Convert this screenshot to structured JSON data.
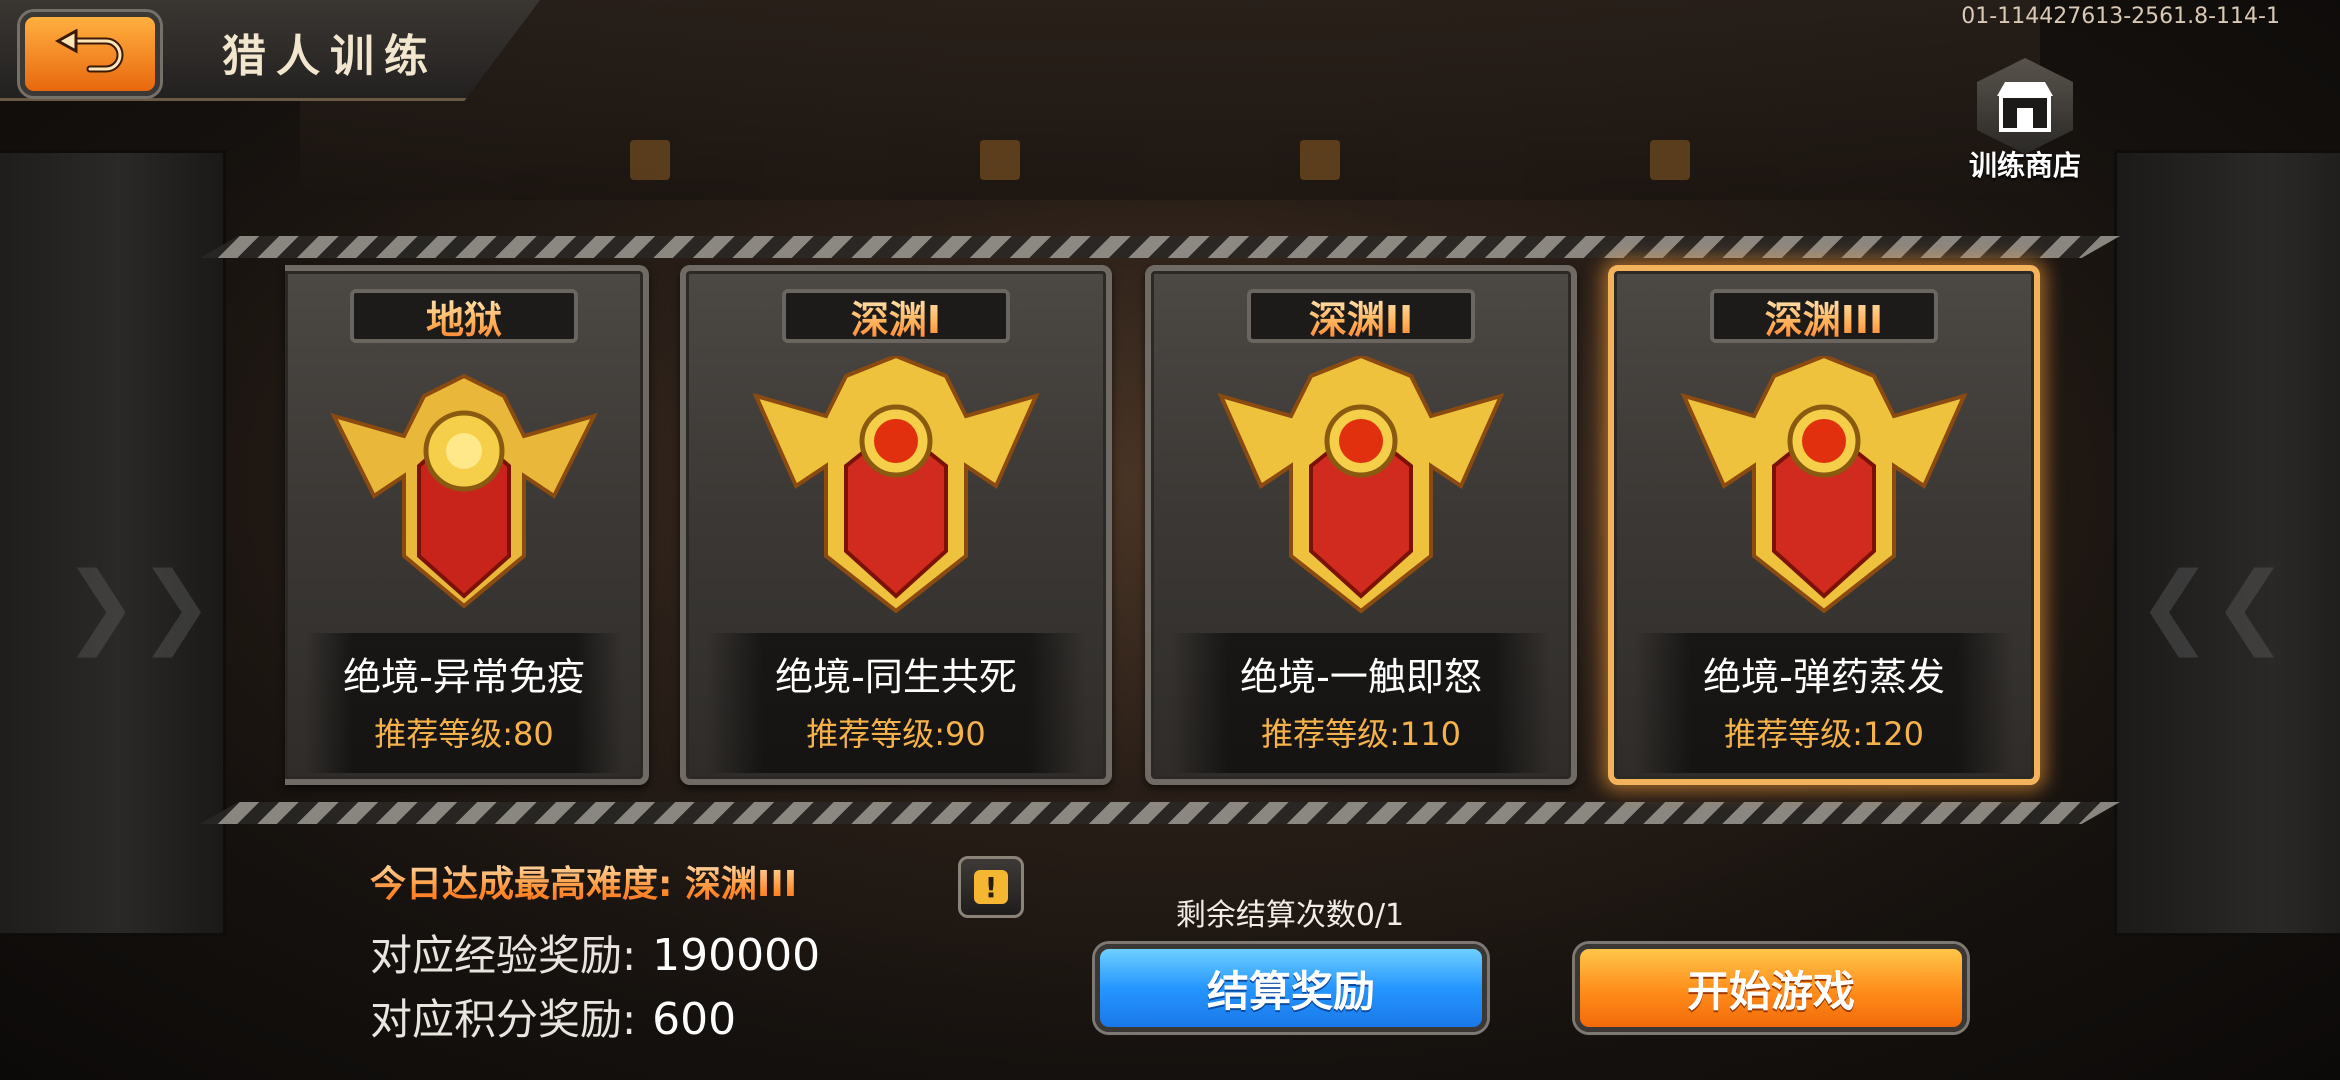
{
  "header": {
    "title": "猎人训练",
    "build_id": "01-114427613-2561.8-114-1"
  },
  "shop": {
    "label": "训练商店",
    "icon": "shop-icon"
  },
  "cards": [
    {
      "tab": "地狱",
      "name": "绝境-异常免疫",
      "level": "推荐等级:80",
      "selected": false
    },
    {
      "tab": "深渊I",
      "name": "绝境-同生共死",
      "level": "推荐等级:90",
      "selected": false
    },
    {
      "tab": "深渊II",
      "name": "绝境-一触即怒",
      "level": "推荐等级:110",
      "selected": false
    },
    {
      "tab": "深渊III",
      "name": "绝境-弹药蒸发",
      "level": "推荐等级:120",
      "selected": true
    }
  ],
  "summary": {
    "best_difficulty": "今日达成最高难度: 深渊III",
    "exp_label": "对应经验奖励:",
    "exp_value": "190000",
    "points_label": "对应积分奖励:",
    "points_value": "600",
    "info_icon": "!"
  },
  "actions": {
    "remaining": "剩余结算次数0/1",
    "settle": "结算奖励",
    "start": "开始游戏"
  },
  "colors": {
    "accent_orange": "#ff8c1a",
    "accent_blue": "#2596ff",
    "level_text": "#f6b24a",
    "selected_glow": "#f3b25c"
  }
}
